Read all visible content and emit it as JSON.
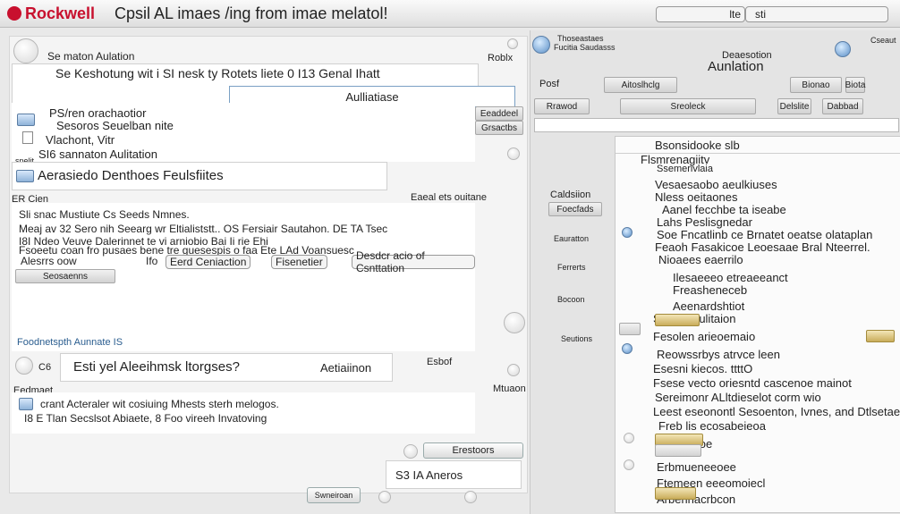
{
  "titlebar": {
    "logo": "Rockwell",
    "title": "Cpsil AL imaes /ing from imae melatol!",
    "field1": "lte",
    "field2": "sti"
  },
  "left": {
    "header": {
      "title": "Se maton Aulation",
      "right": "Roblx"
    },
    "form_line": "Se Keshotung wit i SI nesk ty Rotets liete 0 I13 Genal Ihatt",
    "input_value": "Aulliatiase",
    "bullets": [
      "PS/ren orachaotior",
      "Sesoros Seuelban nite",
      "Vlachont, Vitr"
    ],
    "bullet_note": "SI6 sannaton Aulitation",
    "side_btns": [
      "Eeaddeel",
      "Grsactbs"
    ],
    "section2_title": "Aerasiedo Denthoes Feulsfiites",
    "section2_left_label": "ER Cien",
    "section2_right_label": "Eaeal ets ouitane",
    "line_a": "Sli snac Mustiute Cs Seeds Nmnes.",
    "line_b": "Meaj av 32 Sero nih Seearg wr Eltialiststt.. OS Fersiair Sautahon. DE TA Tsec",
    "line_c": "I8I Ndeo Veuve Dalerinnet te vi arniobio Bai Ii rie Ehi",
    "line_d": "Fsoeetu coan fro pusaes bene tre guesespis o faa Ete LAd Voansuesc",
    "chip1": "Alesrrs oow",
    "chip2": "Ifo",
    "chip3": "Eerd Ceniaction",
    "chip4": "Fisenetier",
    "chip5": "Desdcr acio of Csnttation",
    "small_btn": "Seosaenns",
    "footer_link": "Foodnetspth Aunnate IS",
    "section3_title": "Esti yel Aleeihmsk ltorgses?",
    "section3_right": "Aetiaiinon",
    "section3_btn": "Esbof",
    "section3_left": "Eedmaet",
    "section3_right2": "Mtuaon",
    "section3_line1": "crant Acteraler wit cosiuing Mhests sterh melogos.",
    "section3_line2": "I8 E Tlan Secslsot Abiaete, 8 Foo vireeh Invatoving",
    "bottom_btn": "Erestoors",
    "bottom_text": "S3 IA Aneros",
    "footer_small": "Swneiroan"
  },
  "right": {
    "top_left_text1": "Thoseastaes",
    "top_left_text2": "Fucitia Saudasss",
    "top_right_text": "Cseaut",
    "section_sub": "Deaesotion",
    "section_title": "Aunlation",
    "btns_row1": [
      "Posf",
      "Aitoslhclg",
      "Bionao",
      "Biota"
    ],
    "btns_row2": [
      "Rrawod",
      "Sreoleck",
      "Delslite",
      "Dabbad"
    ],
    "search_placeholder": "",
    "side_labels": [
      "Caldsiion",
      "Eauratton",
      "Ferrerts",
      "Bocoon",
      "Seutions"
    ],
    "side_btn": "Foecfads",
    "list": [
      "Bsonsidooke slb",
      "Flsmrenagiitv",
      "Ssemerivlaia",
      "Vesaesaobo aeulkiuses",
      "Nless oeitaones",
      "Aanel fecchbe ta iseabe",
      "Lahs Peslisgnedar",
      "Soe Fncatlinb ce Brnatet oeatse olataplan",
      "Feaoh Fasakicoe Leoesaae Bral Nteerrel.",
      "Nioaees eaerrilo",
      "Ilesaeeeo etreaeeanct",
      "Freasheneceb",
      "Aeenardshtiot",
      "Sesonl Aulitaion",
      "Fesolen arieoemaio",
      "Reowssrbys atrvce leen",
      "Esesni kiecos. ttttO",
      "Fsese vecto oriesntd cascenoe mainot",
      "Sereimonr ALltdieselot corm wio",
      "Leest eseonontl Sesoenton, Ivnes, and Dtlsetaes.",
      "Freb lis ecosabeieoa",
      "Eieooeeoe",
      "Erbmueneeoee",
      "Ftemeen eeeomoiecl",
      "Arberlnacrbcon"
    ]
  }
}
